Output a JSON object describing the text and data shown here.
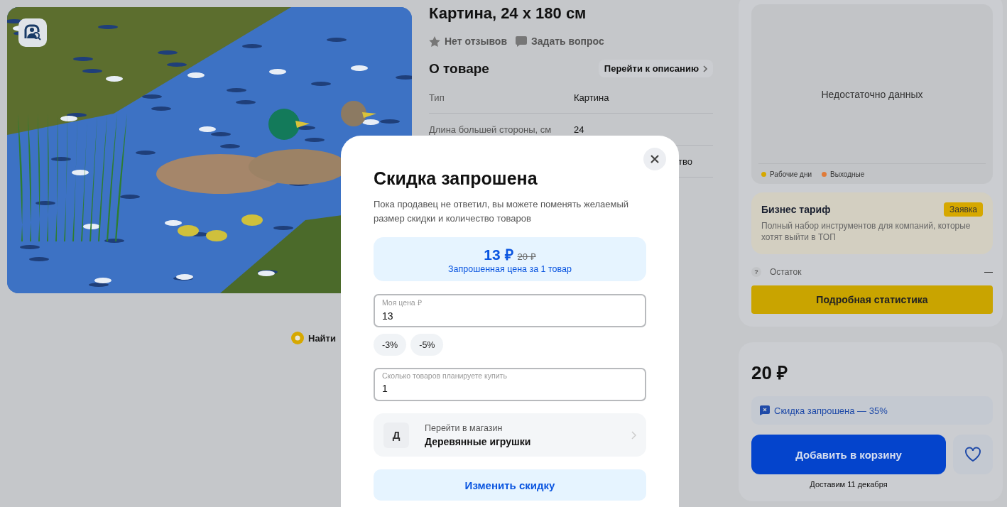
{
  "gallery": {
    "find_link": "Найти"
  },
  "product": {
    "title": "Картина, 24 x 180 см",
    "reviews": "Нет отзывов",
    "ask": "Задать вопрос",
    "about_heading": "О товаре",
    "description_link": "Перейти к описанию",
    "specs": [
      {
        "name": "Тип",
        "value": "Картина"
      },
      {
        "name": "Длина большей стороны, см",
        "value": "24"
      },
      {
        "value": "тво"
      }
    ]
  },
  "stats": {
    "empty_text": "Недостаточно данных",
    "legend": [
      {
        "label": "Рабочие дни",
        "color": "#d6a800"
      },
      {
        "label": "Выходные",
        "color": "#e07b39"
      }
    ],
    "business": {
      "title": "Бизнес тариф",
      "badge": "Заявка",
      "text": "Полный набор инструментов для компаний, которые хотят выйти в ТОП"
    },
    "stock": {
      "help": "?",
      "label": "Остаток",
      "value": "—"
    },
    "button": "Подробная статистика"
  },
  "buy": {
    "price": "20 ₽",
    "discount_status": "Скидка запрошена — 35%",
    "cart_button": "Добавить в корзину",
    "delivery": "Доставим 11 декабря"
  },
  "modal": {
    "title": "Скидка запрошена",
    "subtitle": "Пока продавец не ответил, вы можете поменять желаемый размер скидки и количество товаров",
    "new_price": "13 ₽",
    "old_price": "20 ₽",
    "price_caption": "Запрошенная цена за 1 товар",
    "fields": [
      {
        "label": "Моя цена ₽",
        "value": "13"
      },
      {
        "label": "Сколько товаров планируете купить",
        "value": "1"
      }
    ],
    "chips": [
      "-3%",
      "-5%"
    ],
    "store": {
      "avatar": "Д",
      "caption": "Перейти в магазин",
      "name": "Деревянные игрушки"
    },
    "button": "Изменить скидку"
  }
}
